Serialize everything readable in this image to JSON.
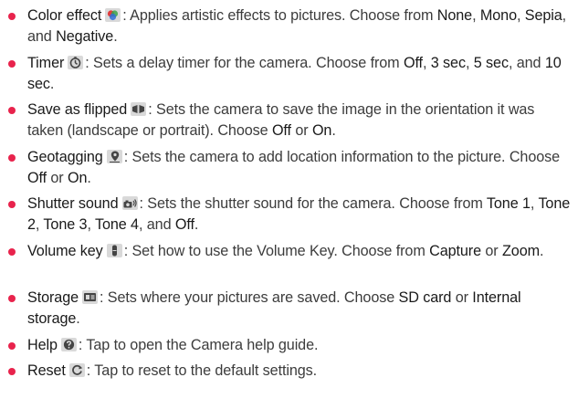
{
  "items": [
    {
      "term": "Color effect",
      "icon": "color-effect-icon",
      "desc": ": Applies artistic effects to pictures. Choose from ",
      "options": [
        "None",
        "Mono",
        "Sepia",
        "Negative"
      ],
      "seps": [
        ", ",
        ", ",
        ", and ",
        "."
      ]
    },
    {
      "term": "Timer",
      "icon": "timer-icon",
      "desc": ": Sets a delay timer for the camera. Choose from ",
      "options": [
        "Off",
        "3 sec",
        "5 sec",
        "10 sec"
      ],
      "seps": [
        ", ",
        ", ",
        ", and ",
        "."
      ]
    },
    {
      "term": "Save as flipped",
      "icon": "save-as-flipped-icon",
      "desc": ": Sets the camera to save the image in the orientation it was taken (landscape or portrait). Choose ",
      "options": [
        "Off",
        "On"
      ],
      "seps": [
        " or ",
        "."
      ]
    },
    {
      "term": "Geotagging",
      "icon": "geotagging-icon",
      "desc": ": Sets the camera to add location information to the picture. Choose ",
      "options": [
        "Off",
        "On"
      ],
      "seps": [
        " or ",
        "."
      ]
    },
    {
      "term": "Shutter sound",
      "icon": "shutter-sound-icon",
      "desc": ": Sets the shutter sound for the camera. Choose from ",
      "options": [
        "Tone 1",
        "Tone 2",
        "Tone 3",
        "Tone 4",
        "Off"
      ],
      "seps": [
        ", ",
        ", ",
        ", ",
        ", and ",
        "."
      ]
    },
    {
      "term": "Volume key",
      "icon": "volume-key-icon",
      "desc": ": Set how to use the Volume Key. Choose from ",
      "options": [
        "Capture",
        "Zoom"
      ],
      "seps": [
        " or ",
        "."
      ]
    },
    {
      "term": "Storage",
      "icon": "storage-icon",
      "desc": ": Sets where your pictures are saved. Choose ",
      "options": [
        "SD card",
        "Internal storage"
      ],
      "seps": [
        " or ",
        "."
      ]
    },
    {
      "term": "Help",
      "icon": "help-icon",
      "desc": ": Tap to open the Camera help guide.",
      "options": [],
      "seps": []
    },
    {
      "term": "Reset",
      "icon": "reset-icon",
      "desc": ": Tap to reset to the default settings.",
      "options": [],
      "seps": []
    }
  ],
  "colors": {
    "bullet": "#e8234c",
    "text": "#3c3c3c",
    "icon_bg": "#d9d9d9"
  }
}
